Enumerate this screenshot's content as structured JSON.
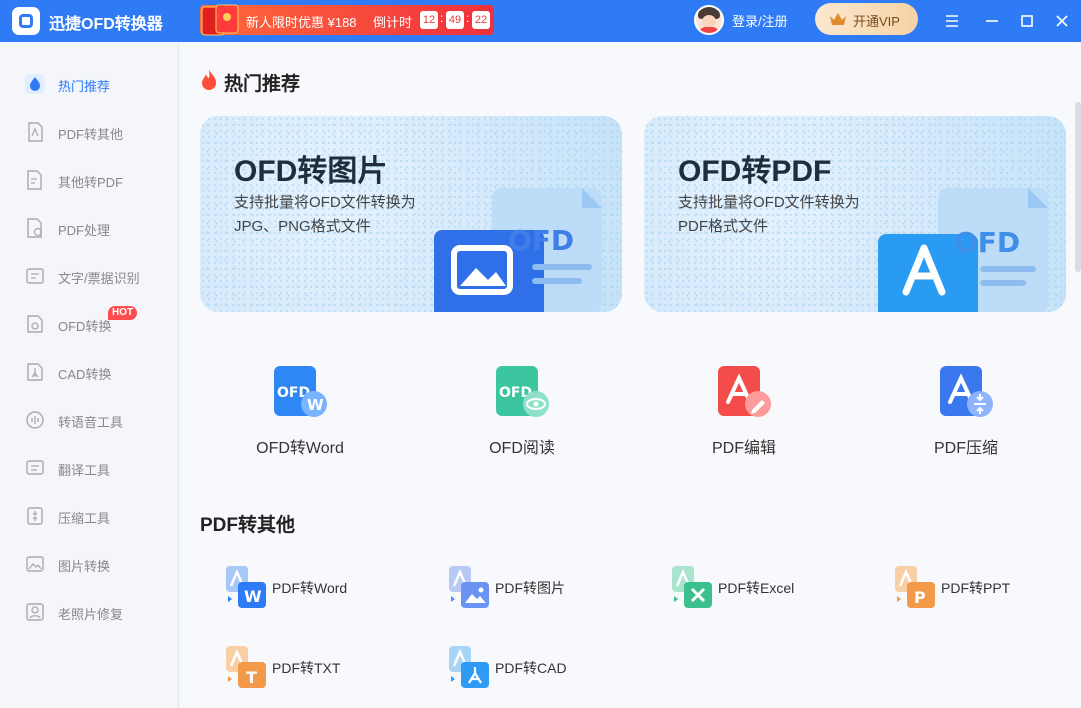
{
  "app": {
    "title": "迅捷OFD转换器"
  },
  "promo": {
    "text": "新人限时优惠 ¥188",
    "countdown_label": "倒计时",
    "hours": "12",
    "minutes": "49",
    "seconds": "22"
  },
  "account": {
    "login_label": "登录/注册",
    "vip_label": "开通VIP"
  },
  "sidebar": {
    "items": [
      {
        "label": "热门推荐",
        "icon": "fire-drop-icon",
        "active": true
      },
      {
        "label": "PDF转其他",
        "icon": "pdf-convert-icon"
      },
      {
        "label": "其他转PDF",
        "icon": "to-pdf-icon"
      },
      {
        "label": "PDF处理",
        "icon": "pdf-process-icon"
      },
      {
        "label": "文字/票据识别",
        "icon": "ocr-icon"
      },
      {
        "label": "OFD转换",
        "icon": "ofd-icon",
        "badge": "HOT"
      },
      {
        "label": "CAD转换",
        "icon": "cad-icon"
      },
      {
        "label": "转语音工具",
        "icon": "voice-icon"
      },
      {
        "label": "翻译工具",
        "icon": "translate-icon"
      },
      {
        "label": "压缩工具",
        "icon": "compress-icon"
      },
      {
        "label": "图片转换",
        "icon": "image-icon"
      },
      {
        "label": "老照片修复",
        "icon": "photo-restore-icon"
      }
    ]
  },
  "hot": {
    "title": "热门推荐",
    "banners": [
      {
        "title": "OFD转图片",
        "desc": "支持批量将OFD文件转换为JPG、PNG格式文件"
      },
      {
        "title": "OFD转PDF",
        "desc": "支持批量将OFD文件转换为PDF格式文件"
      }
    ],
    "tools": [
      {
        "label": "OFD转Word"
      },
      {
        "label": "OFD阅读"
      },
      {
        "label": "PDF编辑"
      },
      {
        "label": "PDF压缩"
      }
    ]
  },
  "pdf_other": {
    "title": "PDF转其他",
    "items": [
      {
        "label": "PDF转Word",
        "color": "#2f7bf5",
        "letter": "W"
      },
      {
        "label": "PDF转图片",
        "color": "#5b8cf0",
        "letter": ""
      },
      {
        "label": "PDF转Excel",
        "color": "#3cc08e",
        "letter": "X"
      },
      {
        "label": "PDF转PPT",
        "color": "#f29a4a",
        "letter": "P"
      },
      {
        "label": "PDF转TXT",
        "color": "#f29a4a",
        "letter": "T"
      },
      {
        "label": "PDF转CAD",
        "color": "#2f9bf5",
        "letter": ""
      }
    ]
  },
  "colors": {
    "primary": "#2f7bf5",
    "promo": "#f0303d",
    "vip": "#f6d3a5"
  }
}
